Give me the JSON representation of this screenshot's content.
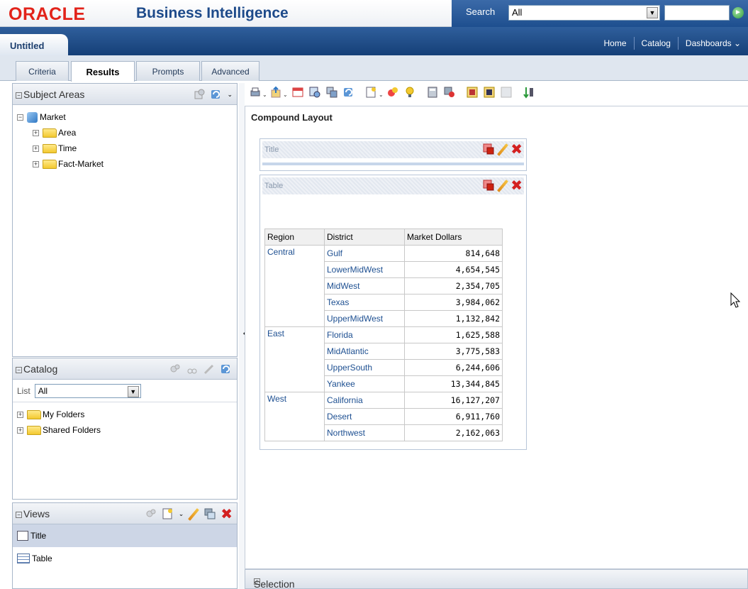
{
  "header": {
    "brand": "ORACLE",
    "product": "Business Intelligence",
    "search_label": "Search",
    "search_scope": "All",
    "search_value": ""
  },
  "nav": {
    "document_tab": "Untitled",
    "links": [
      "Home",
      "Catalog",
      "Dashboards ⌄"
    ]
  },
  "tabs": [
    "Criteria",
    "Results",
    "Prompts",
    "Advanced"
  ],
  "active_tab": "Results",
  "subject_areas": {
    "title": "Subject Areas",
    "root": "Market",
    "children": [
      "Area",
      "Time",
      "Fact-Market"
    ]
  },
  "catalog": {
    "title": "Catalog",
    "list_label": "List",
    "list_value": "All",
    "folders": [
      "My Folders",
      "Shared Folders"
    ]
  },
  "views": {
    "title": "Views",
    "items": [
      "Title",
      "Table"
    ],
    "selected": "Title"
  },
  "layout": {
    "title": "Compound Layout",
    "views": [
      {
        "name": "Title"
      },
      {
        "name": "Table"
      }
    ]
  },
  "table": {
    "headers": [
      "Region",
      "District",
      "Market Dollars"
    ],
    "groups": [
      {
        "region": "Central",
        "rows": [
          {
            "district": "Gulf",
            "value": "814,648"
          },
          {
            "district": "LowerMidWest",
            "value": "4,654,545"
          },
          {
            "district": "MidWest",
            "value": "2,354,705"
          },
          {
            "district": "Texas",
            "value": "3,984,062"
          },
          {
            "district": "UpperMidWest",
            "value": "1,132,842"
          }
        ]
      },
      {
        "region": "East",
        "rows": [
          {
            "district": "Florida",
            "value": "1,625,588"
          },
          {
            "district": "MidAtlantic",
            "value": "3,775,583"
          },
          {
            "district": "UpperSouth",
            "value": "6,244,606"
          },
          {
            "district": "Yankee",
            "value": "13,344,845"
          }
        ]
      },
      {
        "region": "West",
        "rows": [
          {
            "district": "California",
            "value": "16,127,207"
          },
          {
            "district": "Desert",
            "value": "6,911,760"
          },
          {
            "district": "Northwest",
            "value": "2,162,063"
          }
        ]
      }
    ]
  },
  "selection_steps": {
    "title": "Selection Steps"
  },
  "colors": {
    "brand_red": "#e2231a",
    "title_blue": "#1d4a8a",
    "nav_blue": "#1e4f8f",
    "link_blue": "#1d4f91",
    "delete_red": "#d32020"
  },
  "icons": [
    "refresh-icon",
    "print-icon",
    "export-icon",
    "new-view-icon",
    "delete-icon",
    "edit-icon",
    "folder-icon",
    "expand-icon"
  ]
}
